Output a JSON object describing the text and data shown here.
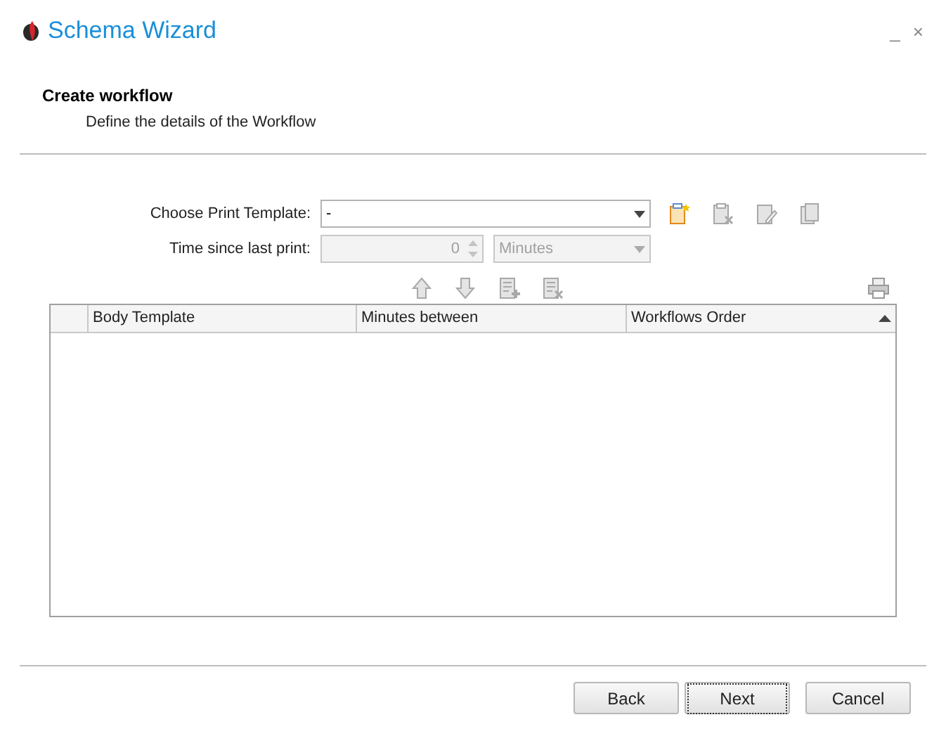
{
  "window": {
    "title": "Schema Wizard",
    "controls": [
      "_",
      "×"
    ]
  },
  "header": {
    "title": "Create workflow",
    "subtitle": "Define the details of the Workflow"
  },
  "form": {
    "template": {
      "label": "Choose Print Template:",
      "value": "-",
      "disabled": false
    },
    "time": {
      "label": "Time since last print:",
      "value": "0",
      "unit": "Minutes",
      "disabled": true
    }
  },
  "template_tools": [
    {
      "kind": "new",
      "disabled": false
    },
    {
      "kind": "delete",
      "disabled": true
    },
    {
      "kind": "edit",
      "disabled": true
    },
    {
      "kind": "copy",
      "disabled": true
    }
  ],
  "grid_tools": [
    {
      "kind": "up",
      "disabled": true
    },
    {
      "kind": "down",
      "disabled": true
    },
    {
      "kind": "add",
      "disabled": true
    },
    {
      "kind": "remove",
      "disabled": true
    }
  ],
  "table": {
    "columns": [
      {
        "label": "Body Template",
        "sorted": false
      },
      {
        "label": "Minutes between",
        "sorted": false
      },
      {
        "label": "Workflows Order",
        "sorted": true
      }
    ]
  },
  "buttons": [
    {
      "label": "Back",
      "focused": false
    },
    {
      "label": "Next",
      "focused": true
    },
    {
      "label": "Cancel",
      "focused": false
    }
  ]
}
